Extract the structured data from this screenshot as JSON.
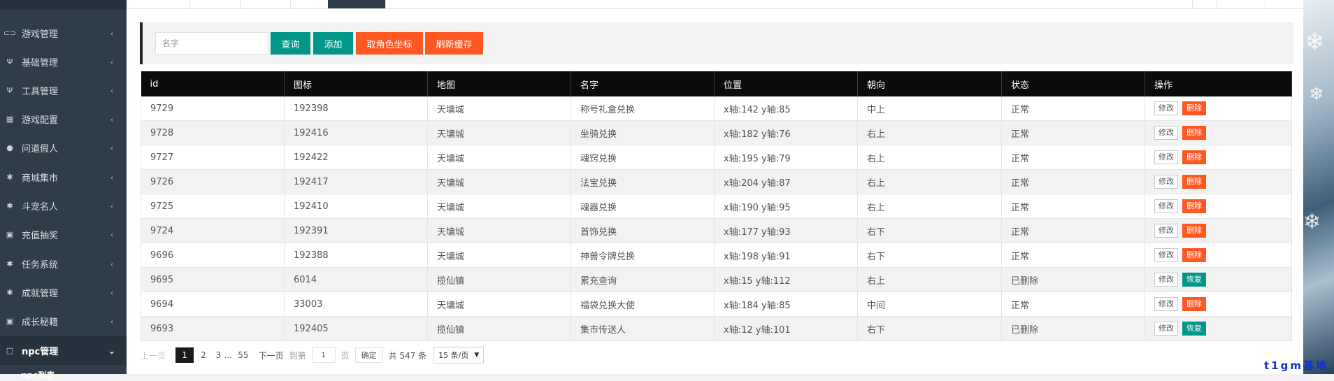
{
  "sidebar": {
    "items": [
      {
        "label": "游戏管理",
        "icon": "gamepad-icon",
        "glyph": "⊂⊃"
      },
      {
        "label": "基础管理",
        "icon": "utensils-icon",
        "glyph": "Ψ"
      },
      {
        "label": "工具管理",
        "icon": "utensils-icon",
        "glyph": "Ψ"
      },
      {
        "label": "游戏配置",
        "icon": "table-icon",
        "glyph": "▦"
      },
      {
        "label": "问道假人",
        "icon": "user-icon",
        "glyph": "●"
      },
      {
        "label": "商城集市",
        "icon": "asterisk-icon",
        "glyph": "✱"
      },
      {
        "label": "斗宠名人",
        "icon": "asterisk-icon",
        "glyph": "✱"
      },
      {
        "label": "充值抽奖",
        "icon": "money-icon",
        "glyph": "▣"
      },
      {
        "label": "任务系统",
        "icon": "asterisk-icon",
        "glyph": "✱"
      },
      {
        "label": "成就管理",
        "icon": "asterisk-icon",
        "glyph": "✱"
      },
      {
        "label": "成长秘籍",
        "icon": "money-icon",
        "glyph": "▣"
      },
      {
        "label": "npc管理",
        "icon": "square-icon",
        "glyph": "□",
        "active": true
      }
    ],
    "sub_item": "npc列表"
  },
  "search": {
    "placeholder": "名字",
    "query_label": "查询",
    "add_label": "添加",
    "coord_label": "取角色坐标",
    "refresh_label": "刷新缓存"
  },
  "table": {
    "columns": [
      "id",
      "图标",
      "地图",
      "名字",
      "位置",
      "朝向",
      "状态",
      "操作"
    ],
    "edit_label": "修改",
    "delete_label": "删除",
    "restore_label": "恢复",
    "rows": [
      {
        "id": "9729",
        "icon": "192398",
        "map": "天墉城",
        "name": "称号礼盒兑换",
        "pos": "x轴:142 y轴:85",
        "dir": "中上",
        "status": "正常",
        "deleted": false
      },
      {
        "id": "9728",
        "icon": "192416",
        "map": "天墉城",
        "name": "坐骑兑换",
        "pos": "x轴:182 y轴:76",
        "dir": "右上",
        "status": "正常",
        "deleted": false
      },
      {
        "id": "9727",
        "icon": "192422",
        "map": "天墉城",
        "name": "魂窍兑换",
        "pos": "x轴:195 y轴:79",
        "dir": "右上",
        "status": "正常",
        "deleted": false
      },
      {
        "id": "9726",
        "icon": "192417",
        "map": "天墉城",
        "name": "法宝兑换",
        "pos": "x轴:204 y轴:87",
        "dir": "右上",
        "status": "正常",
        "deleted": false
      },
      {
        "id": "9725",
        "icon": "192410",
        "map": "天墉城",
        "name": "魂器兑换",
        "pos": "x轴:190 y轴:95",
        "dir": "右上",
        "status": "正常",
        "deleted": false
      },
      {
        "id": "9724",
        "icon": "192391",
        "map": "天墉城",
        "name": "首饰兑换",
        "pos": "x轴:177 y轴:93",
        "dir": "右下",
        "status": "正常",
        "deleted": false
      },
      {
        "id": "9696",
        "icon": "192388",
        "map": "天墉城",
        "name": "神兽令牌兑换",
        "pos": "x轴:198 y轴:91",
        "dir": "右下",
        "status": "正常",
        "deleted": false
      },
      {
        "id": "9695",
        "icon": "6014",
        "map": "揽仙镇",
        "name": "累充查询",
        "pos": "x轴:15 y轴:112",
        "dir": "右上",
        "status": "已删除",
        "deleted": true
      },
      {
        "id": "9694",
        "icon": "33003",
        "map": "天墉城",
        "name": "福袋兑换大使",
        "pos": "x轴:184 y轴:85",
        "dir": "中间",
        "status": "正常",
        "deleted": false
      },
      {
        "id": "9693",
        "icon": "192405",
        "map": "揽仙镇",
        "name": "集市传送人",
        "pos": "x轴:12 y轴:101",
        "dir": "右下",
        "status": "已删除",
        "deleted": true
      }
    ]
  },
  "pager": {
    "prev": "上一页",
    "pages": [
      "1",
      "2",
      "3"
    ],
    "ellipsis": "…",
    "last": "55",
    "next": "下一页",
    "goto_label": "到第",
    "goto_value": "1",
    "page_unit": "页",
    "confirm": "确定",
    "total": "共 547 条",
    "per_page": "15 条/页"
  },
  "watermark": "t1gm基地",
  "colors": {
    "sidebar_bg": "#2f3d4a",
    "teal": "#009688",
    "orange": "#ff5722",
    "header_bg": "#0b0b0b"
  }
}
